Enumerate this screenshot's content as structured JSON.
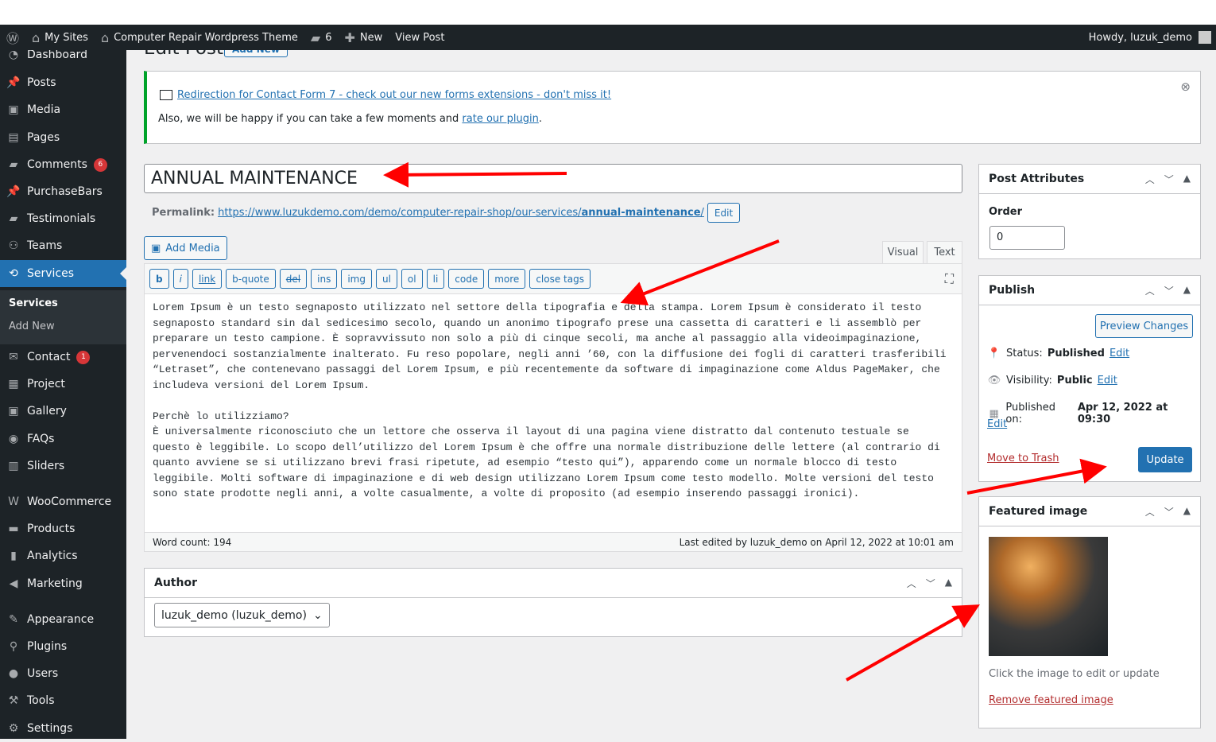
{
  "adminbar": {
    "my_sites": "My Sites",
    "site_name": "Computer Repair Wordpress Theme",
    "comments_count": "6",
    "new": "New",
    "view_post": "View Post",
    "howdy": "Howdy, luzuk_demo"
  },
  "sidebar": {
    "items": [
      {
        "label": "Dashboard",
        "icon": "dashboard-icon"
      },
      {
        "label": "Posts",
        "icon": "pin-icon"
      },
      {
        "label": "Media",
        "icon": "media-icon"
      },
      {
        "label": "Pages",
        "icon": "page-icon"
      },
      {
        "label": "Comments",
        "icon": "comment-icon",
        "badge": "6"
      },
      {
        "label": "PurchaseBars",
        "icon": "pin-icon"
      },
      {
        "label": "Testimonials",
        "icon": "comments-icon"
      },
      {
        "label": "Teams",
        "icon": "groups-icon"
      },
      {
        "label": "Services",
        "icon": "services-icon",
        "active": true
      },
      {
        "label": "Contact",
        "icon": "mail-icon",
        "badge": "1"
      },
      {
        "label": "Project",
        "icon": "grid-icon"
      },
      {
        "label": "Gallery",
        "icon": "media-icon"
      },
      {
        "label": "FAQs",
        "icon": "faq-icon"
      },
      {
        "label": "Sliders",
        "icon": "slides-icon"
      },
      {
        "label": "WooCommerce",
        "icon": "woo-icon"
      },
      {
        "label": "Products",
        "icon": "archive-icon"
      },
      {
        "label": "Analytics",
        "icon": "chart-icon"
      },
      {
        "label": "Marketing",
        "icon": "megaphone-icon"
      },
      {
        "label": "Appearance",
        "icon": "brush-icon"
      },
      {
        "label": "Plugins",
        "icon": "plugin-icon"
      },
      {
        "label": "Users",
        "icon": "user-icon"
      },
      {
        "label": "Tools",
        "icon": "wrench-icon"
      },
      {
        "label": "Settings",
        "icon": "settings-icon"
      }
    ],
    "submenu": [
      "Services",
      "Add New"
    ]
  },
  "page": {
    "title": "Edit Post",
    "add_new": "Add New"
  },
  "notice": {
    "link": "Redirection for Contact Form 7 - check out our new forms extensions - don't miss it!",
    "text": "Also, we will be happy if you can take a few moments and ",
    "rate_link": "rate our plugin",
    "period": "."
  },
  "post": {
    "title": "ANNUAL MAINTENANCE",
    "permalink_label": "Permalink:",
    "permalink_base": "https://www.luzukdemo.com/demo/computer-repair-shop/our-services/",
    "permalink_slug": "annual-maintenance",
    "permalink_end": "/",
    "edit": "Edit"
  },
  "editor": {
    "add_media": "Add Media",
    "tab_visual": "Visual",
    "tab_text": "Text",
    "quicktags": [
      "b",
      "i",
      "link",
      "b-quote",
      "del",
      "ins",
      "img",
      "ul",
      "ol",
      "li",
      "code",
      "more",
      "close tags"
    ],
    "lines": [
      "Lorem Ipsum è un testo segnaposto utilizzato nel settore della tipografia e della stampa. Lorem Ipsum è considerato il testo",
      "segnaposto standard sin dal sedicesimo secolo, quando un anonimo tipografo prese una cassetta di caratteri e li assemblò per",
      "preparare un testo campione. È sopravvissuto non solo a più di cinque secoli, ma anche al passaggio alla videoimpaginazione,",
      "pervenendoci sostanzialmente inalterato. Fu reso popolare, negli anni ’60, con la diffusione dei fogli di caratteri trasferibili",
      "“Letraset”, che contenevano passaggi del Lorem Ipsum, e più recentemente da software di impaginazione come Aldus PageMaker, che",
      "includeva versioni del Lorem Ipsum.",
      "",
      "Perchè lo utilizziamo?",
      "È universalmente riconosciuto che un lettore che osserva il layout di una pagina viene distratto dal contenuto testuale se",
      "questo è leggibile. Lo scopo dell’utilizzo del Lorem Ipsum è che offre una normale distribuzione delle lettere (al contrario di",
      "quanto avviene se si utilizzano brevi frasi ripetute, ad esempio “testo qui”), apparendo come un normale blocco di testo",
      "leggibile. Molti software di impaginazione e di web design utilizzano Lorem Ipsum come testo modello. Molte versioni del testo",
      "sono state prodotte negli anni, a volte casualmente, a volte di proposito (ad esempio inserendo passaggi ironici)."
    ],
    "word_count": "Word count: 194",
    "last_edited": "Last edited by luzuk_demo on April 12, 2022 at 10:01 am"
  },
  "author": {
    "title": "Author",
    "value": "luzuk_demo (luzuk_demo)"
  },
  "attributes": {
    "title": "Post Attributes",
    "order_label": "Order",
    "order_value": "0"
  },
  "publish": {
    "title": "Publish",
    "preview": "Preview Changes",
    "status_label": "Status: ",
    "status": "Published",
    "visibility_label": "Visibility: ",
    "visibility": "Public",
    "published_label": "Published on: ",
    "published": "Apr 12, 2022 at 09:30",
    "edit": "Edit",
    "trash": "Move to Trash",
    "update": "Update"
  },
  "featured": {
    "title": "Featured image",
    "hint": "Click the image to edit or update",
    "remove": "Remove featured image"
  },
  "colors": {
    "accent": "#2271b1",
    "sidebar": "#1d2327",
    "annotation": "#ff0000"
  }
}
